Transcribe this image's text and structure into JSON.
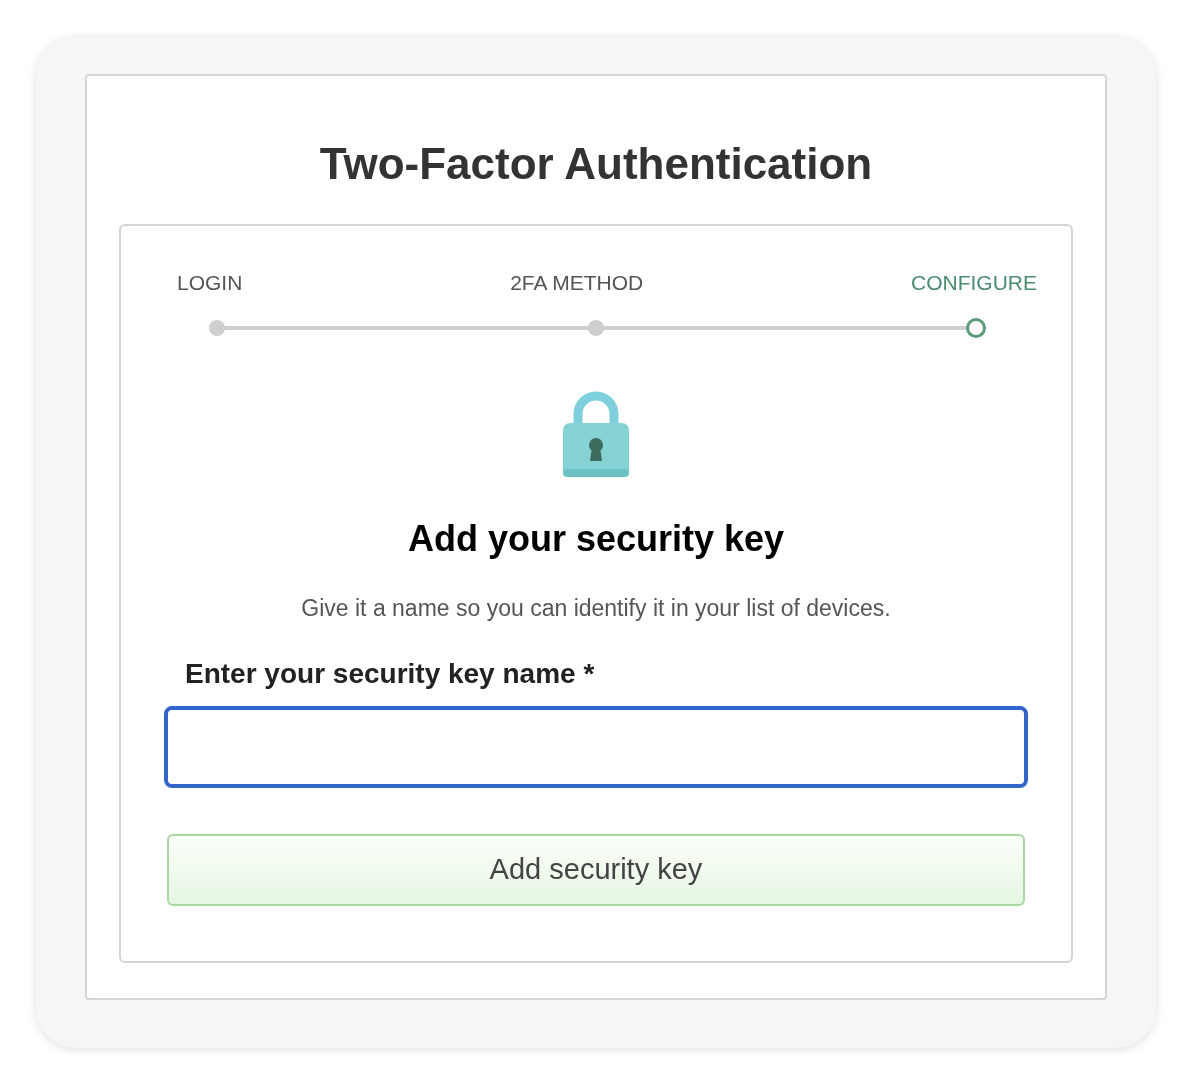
{
  "title": "Two-Factor Authentication",
  "steps": [
    {
      "label": "LOGIN",
      "selected": false
    },
    {
      "label": "2FA METHOD",
      "selected": false
    },
    {
      "label": "CONFIGURE",
      "selected": true
    }
  ],
  "heading": "Add your security key",
  "description": "Give it a name so you can identify it in your list of devices.",
  "field": {
    "label": "Enter your security key name *",
    "focused": true
  },
  "button": {
    "label": "Add security key"
  }
}
